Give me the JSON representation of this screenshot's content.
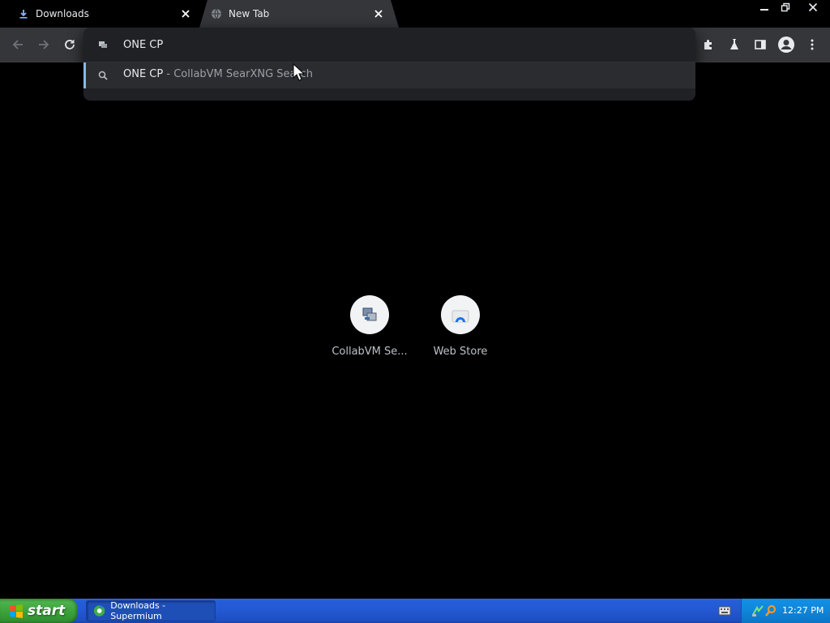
{
  "browser": {
    "tabs": [
      {
        "title": "Downloads",
        "icon": "download-icon",
        "active": false
      },
      {
        "title": "New Tab",
        "icon": "globe-icon",
        "active": true
      }
    ],
    "omnibox": {
      "value": "ONE CP",
      "suggestion": {
        "query": "ONE CP",
        "description": " - CollabVM SearXNG Search"
      }
    },
    "shortcuts": [
      {
        "label": "CollabVM Se...",
        "icon": "collabvm-icon"
      },
      {
        "label": "Web Store",
        "icon": "web-store-icon"
      }
    ],
    "colors": {
      "accent": "#8ab4f8",
      "toolbar": "#35363a",
      "background": "#000000"
    }
  },
  "taskbar": {
    "start_label": "start",
    "active_window": "Downloads - Supermium",
    "clock": "12:27 PM"
  }
}
